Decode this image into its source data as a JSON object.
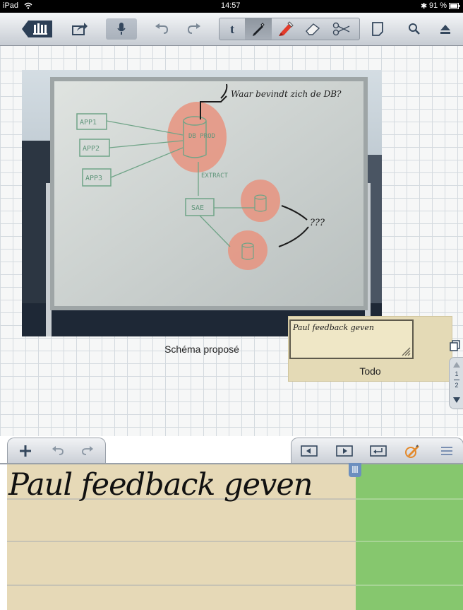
{
  "status_bar": {
    "device": "iPad",
    "time": "14:57",
    "battery": "91 %"
  },
  "toolbar": {
    "icons": [
      "library-icon",
      "share-icon",
      "microphone-icon",
      "undo-icon",
      "redo-icon",
      "text-tool-icon",
      "pen-tool-icon",
      "highlighter-tool-icon",
      "eraser-tool-icon",
      "scissors-tool-icon",
      "page-icon",
      "search-icon",
      "eject-icon"
    ],
    "text_tool_label": "t"
  },
  "canvas": {
    "image_caption": "Schéma proposé",
    "whiteboard": {
      "question": "Waar bevindt zich de DB?",
      "apps": [
        "APP1",
        "APP2",
        "APP3"
      ],
      "db_label": "DB PROD",
      "extract_label": "EXTRACT",
      "sae_label": "SAE",
      "unknown_label": "???"
    },
    "note": {
      "title": "Todo",
      "content": "Paul feedback geven"
    }
  },
  "page_nav": {
    "current": "1",
    "total": "2"
  },
  "writing_toolbar_left": {
    "icons": [
      "add-icon",
      "undo-icon",
      "redo-icon"
    ]
  },
  "writing_toolbar_right": {
    "icons": [
      "cursor-left-icon",
      "cursor-right-icon",
      "return-icon",
      "pen-settings-icon",
      "menu-icon"
    ]
  },
  "writing_area": {
    "text": "Paul feedback geven"
  },
  "colors": {
    "toolbar": "#c7ccd3",
    "note_background": "#e4dab6",
    "writing_background": "#e6d9b7",
    "green_area": "#86c76e"
  }
}
